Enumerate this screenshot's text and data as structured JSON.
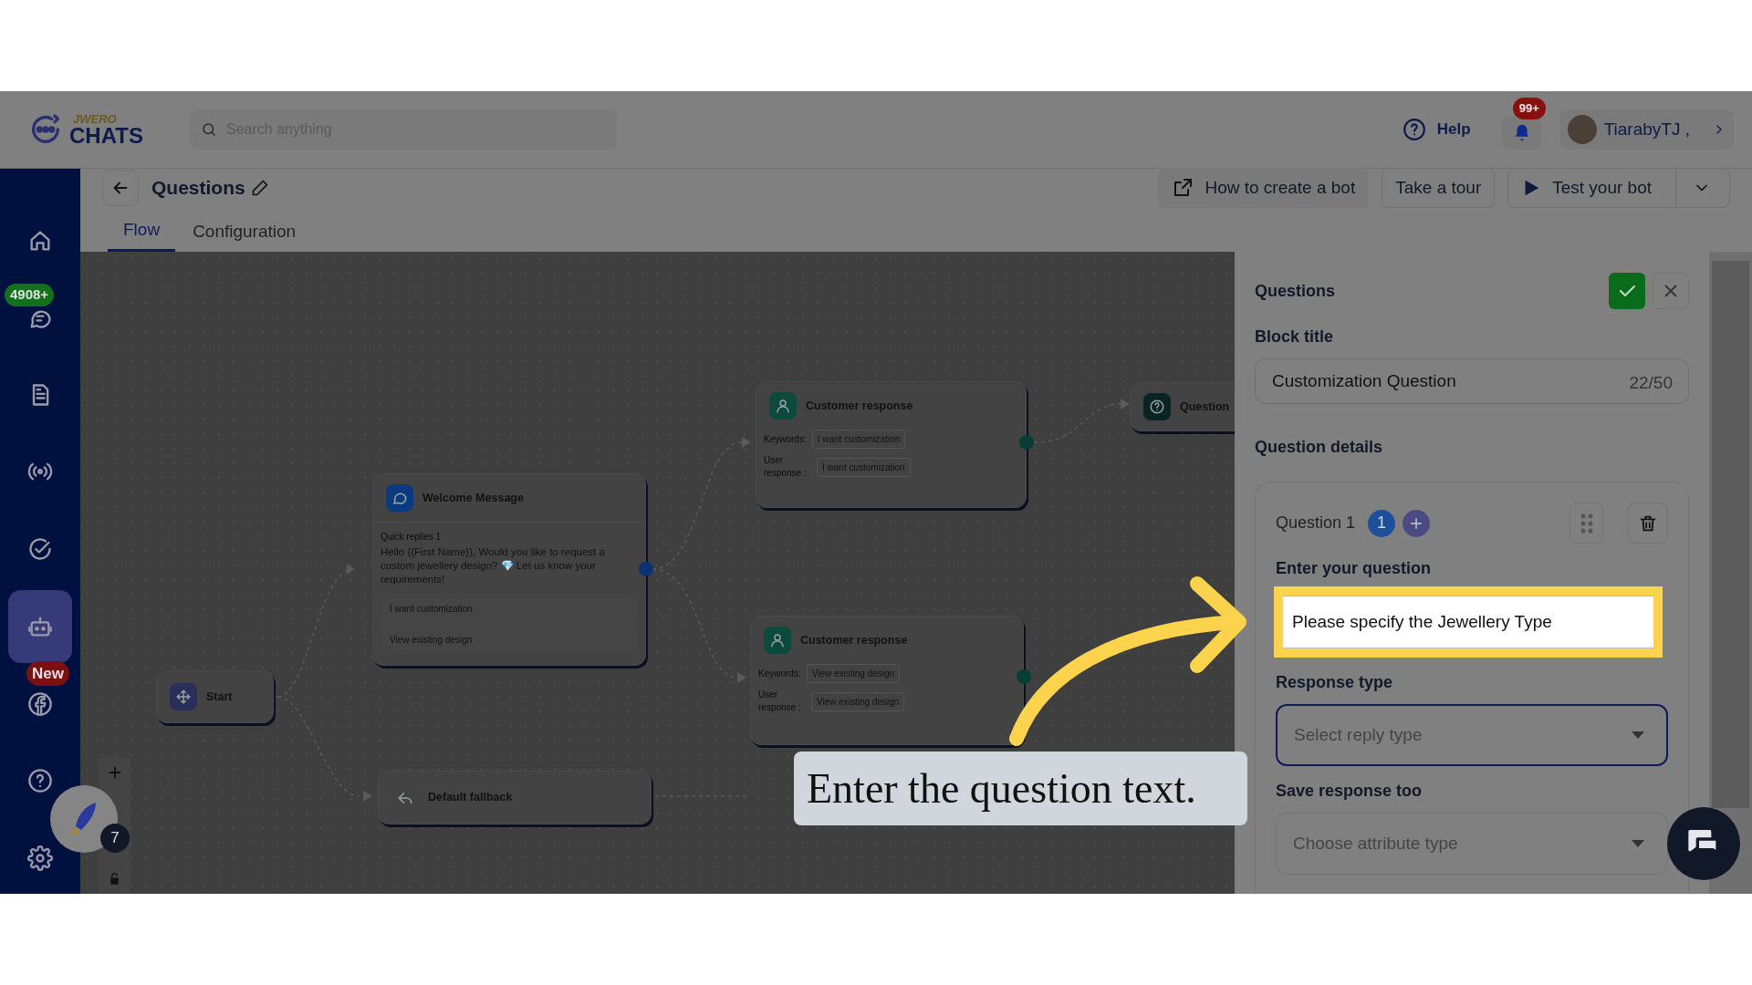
{
  "header": {
    "logo": {
      "brand_top": "JWERO",
      "brand_main": "CHATS"
    },
    "search": {
      "placeholder": "Search anything"
    },
    "help": "Help",
    "notifications_badge": "99+",
    "user": "TiarabyTJ ,"
  },
  "sidebar": {
    "items": [
      {
        "selected": false
      },
      {
        "selected": false,
        "badge": "4908+"
      },
      {
        "selected": false
      },
      {
        "selected": false
      },
      {
        "selected": false
      },
      {
        "selected": true
      },
      {
        "selected": false,
        "badge": "New"
      },
      {
        "selected": false
      },
      {
        "selected": false
      }
    ]
  },
  "page": {
    "title": "Questions",
    "tabs": [
      {
        "label": "Flow",
        "selected": true
      },
      {
        "label": "Configuration",
        "selected": false
      }
    ],
    "actions": [
      {
        "kind": "link",
        "label": "How to create a bot"
      },
      {
        "kind": "plain",
        "label": "Take a tour"
      },
      {
        "kind": "split",
        "label": "Test your bot"
      }
    ]
  },
  "canvas": {
    "nodes": [
      {
        "kind": "response",
        "title": "Customer response",
        "keywords_label": "Keywords:",
        "keyword": "I want customization",
        "user_label": "User response :",
        "user_response": "I want customization"
      },
      {
        "kind": "question",
        "title": "Question"
      },
      {
        "kind": "message",
        "title": "Welcome Message",
        "subtitle": "Quick replies 1",
        "text": "Hello {{First Name}}, Would you like to request a custom jewellery design? 💎 Let us know your requirements!",
        "replies": [
          "I want customization",
          "View existing design"
        ]
      },
      {
        "kind": "response",
        "title": "Customer response",
        "keywords_label": "Keywords:",
        "keyword": "View existing design",
        "user_label": "User response :",
        "user_response": "View existing design"
      },
      {
        "kind": "start",
        "title": "Start"
      },
      {
        "kind": "fallback",
        "title": "Default fallback"
      }
    ]
  },
  "launcher_badge": "7",
  "panel": {
    "title": "Questions",
    "block_title": {
      "label": "Block title",
      "value": "Customization Question",
      "counter": "22/50"
    },
    "section": "Question details",
    "question": {
      "label": "Question 1",
      "number": "1",
      "field_label": "Enter your question",
      "value": "Please specify the Jewellery Type"
    },
    "response_type": {
      "label": "Response type",
      "placeholder": "Select reply type"
    },
    "save_response": {
      "label": "Save response too",
      "placeholder": "Choose attribute type"
    }
  },
  "tutorial": {
    "caption": "Enter the question text."
  }
}
